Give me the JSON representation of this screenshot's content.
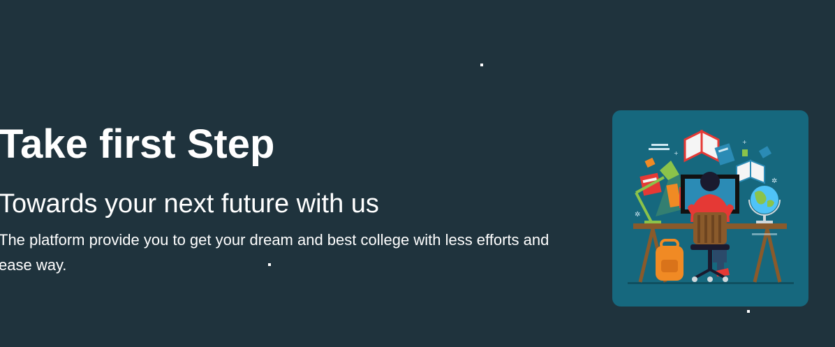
{
  "hero": {
    "headline": "Take first Step",
    "subheadline": "Towards your next future with us",
    "description": "The platform provide you to get your dream and best college with less efforts and ease way."
  },
  "illustration": {
    "icon": "student-at-desk-illustration"
  },
  "colors": {
    "background": "#1f333d",
    "text": "#ffffff",
    "card": "#16687e",
    "shirt": "#e53935",
    "backpack": "#f08a24",
    "lamp": "#8bc34a",
    "desk": "#8a5a2b"
  }
}
